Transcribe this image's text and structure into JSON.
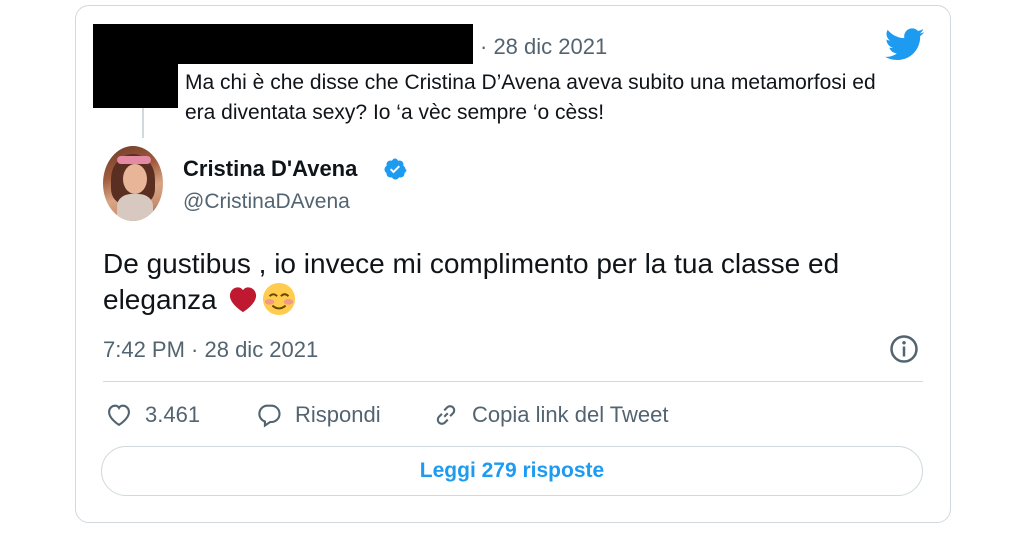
{
  "parent_tweet": {
    "date": "· 28 dic 2021",
    "text": "Ma chi è che disse che Cristina D’Avena aveva subito una metamorfosi ed era diventata sexy? Io ‘a vèc sempre ‘o cèss!"
  },
  "author": {
    "display_name": "Cristina D'Avena",
    "handle": "@CristinaDAvena",
    "verified": true
  },
  "tweet": {
    "text": "De gustibus , io invece mi complimento per la tua classe ed eleganza",
    "emojis": [
      "red-heart",
      "smiling-face-with-blush"
    ],
    "timestamp": "7:42 PM · 28 dic 2021"
  },
  "actions": {
    "likes": "3.461",
    "reply_label": "Rispondi",
    "copy_link_label": "Copia link del Tweet"
  },
  "read_replies_label": "Leggi 279 risposte",
  "colors": {
    "brand": "#1d9bf0",
    "text": "#0f1419",
    "secondary": "#536471",
    "border": "#cfd9de",
    "heart": "#be1931"
  }
}
